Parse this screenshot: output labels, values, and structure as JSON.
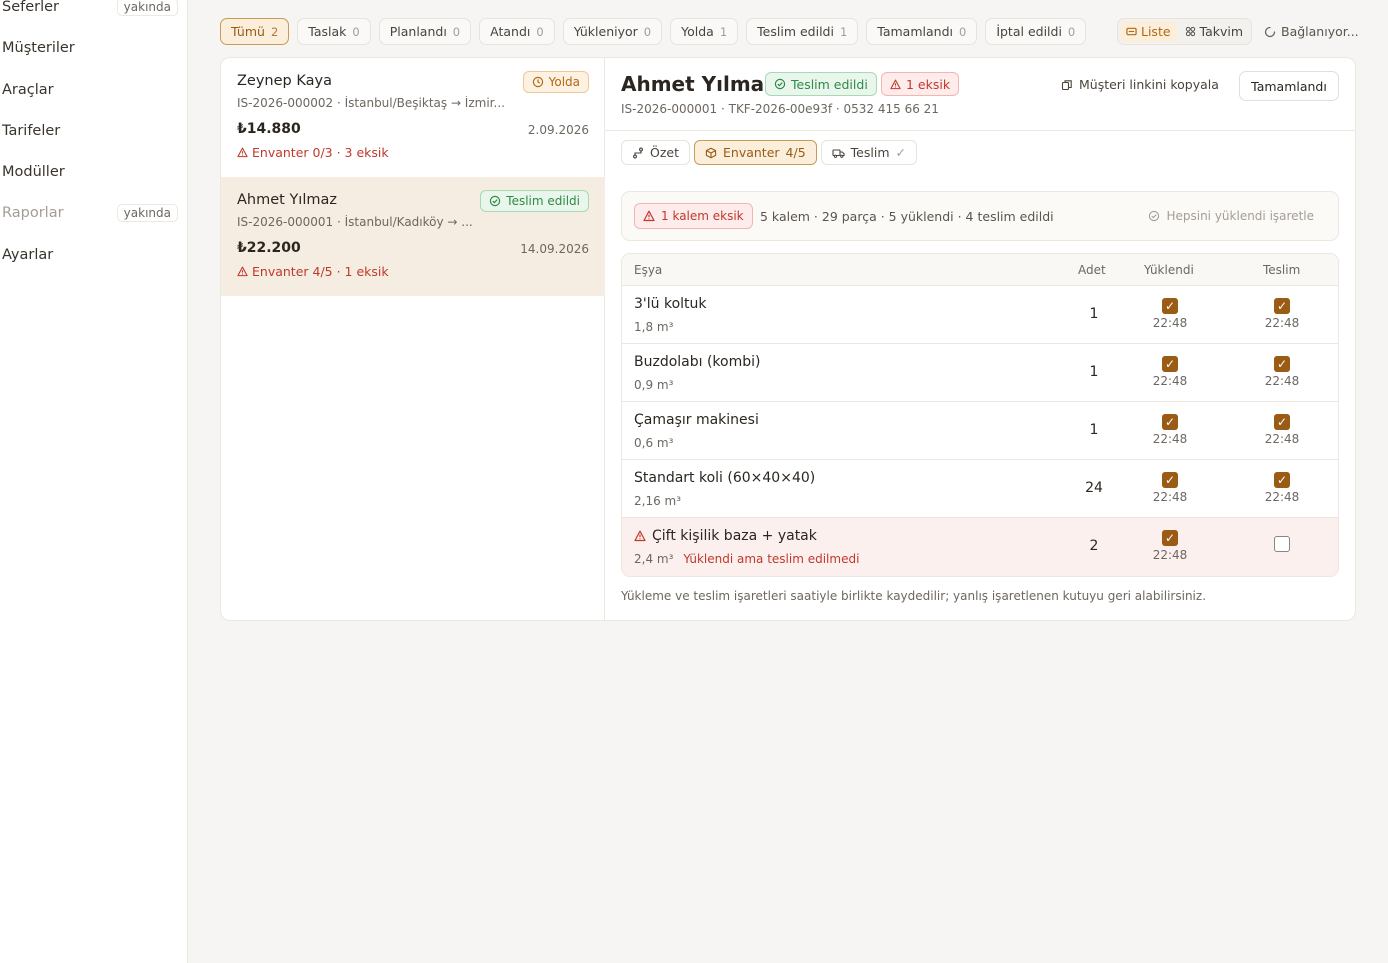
{
  "sidebar": {
    "items": [
      {
        "label": "Seferler",
        "badge": "yakında"
      },
      {
        "label": "Müşteriler"
      },
      {
        "label": "Araçlar"
      },
      {
        "label": "Tarifeler"
      },
      {
        "label": "Modüller"
      },
      {
        "label": "Raporlar",
        "badge": "yakında"
      },
      {
        "label": "Ayarlar"
      }
    ]
  },
  "filters": [
    {
      "label": "Tümü",
      "count": "2"
    },
    {
      "label": "Taslak",
      "count": "0"
    },
    {
      "label": "Planlandı",
      "count": "0"
    },
    {
      "label": "Atandı",
      "count": "0"
    },
    {
      "label": "Yükleniyor",
      "count": "0"
    },
    {
      "label": "Yolda",
      "count": "1"
    },
    {
      "label": "Teslim edildi",
      "count": "1"
    },
    {
      "label": "Tamamlandı",
      "count": "0"
    },
    {
      "label": "İptal edildi",
      "count": "0"
    }
  ],
  "view": {
    "list": "Liste",
    "calendar": "Takvim",
    "status": "Bağlanıyor..."
  },
  "jobs": [
    {
      "name": "Zeynep Kaya",
      "sub": "IS-2026-000002 · İstanbul/Beşiktaş → İzmir...",
      "price": "₺14.880",
      "date": "2.09.2026",
      "warn": "Envanter 0/3 · 3 eksik",
      "status": "Yolda"
    },
    {
      "name": "Ahmet Yılmaz",
      "sub": "IS-2026-000001 · İstanbul/Kadıköy → ...",
      "price": "₺22.200",
      "date": "14.09.2026",
      "warn": "Envanter 4/5 · 1 eksik",
      "status": "Teslim edildi"
    }
  ],
  "detail": {
    "title": "Ahmet Yılmaz",
    "status": "Teslim edildi",
    "missing": "1 eksik",
    "meta": "IS-2026-000001  · TKF-2026-00e93f  · 0532 415 66 21",
    "copy_link": "Müşteri linkini kopyala",
    "done_button": "Tamamlandı",
    "tabs": {
      "summary": "Özet",
      "inventory": "Envanter",
      "inventory_count": "4/5",
      "delivery": "Teslim",
      "delivery_mark": "✓"
    },
    "summary": {
      "missing_chip": "1 kalem eksik",
      "text": "5 kalem · 29 parça · 5 yüklendi · 4 teslim edildi",
      "mark_all": "Hepsini yüklendi işaretle"
    },
    "table": {
      "headers": {
        "item": "Eşya",
        "qty": "Adet",
        "loaded": "Yüklendi",
        "delivered": "Teslim"
      },
      "rows": [
        {
          "name": "3'lü koltuk",
          "vol": "1,8 m³",
          "qty": "1",
          "loaded": "22:48",
          "delivered": "22:48"
        },
        {
          "name": "Buzdolabı (kombi)",
          "vol": "0,9 m³",
          "qty": "1",
          "loaded": "22:48",
          "delivered": "22:48"
        },
        {
          "name": "Çamaşır makinesi",
          "vol": "0,6 m³",
          "qty": "1",
          "loaded": "22:48",
          "delivered": "22:48"
        },
        {
          "name": "Standart koli (60×40×40)",
          "vol": "2,16 m³",
          "qty": "24",
          "loaded": "22:48",
          "delivered": "22:48"
        },
        {
          "name": "Çift kişilik baza + yatak",
          "vol": "2,4 m³",
          "qty": "2",
          "loaded": "22:48",
          "delivered": "",
          "note": "Yüklendi ama teslim edilmedi"
        }
      ]
    },
    "footnote": "Yükleme ve teslim işaretleri saatiyle birlikte kaydedilir; yanlış işaretlenen kutuyu geri alabilirsiniz."
  },
  "colors": {
    "accent": "#9a5b14",
    "danger": "#c0392b",
    "success": "#2f8a46"
  }
}
